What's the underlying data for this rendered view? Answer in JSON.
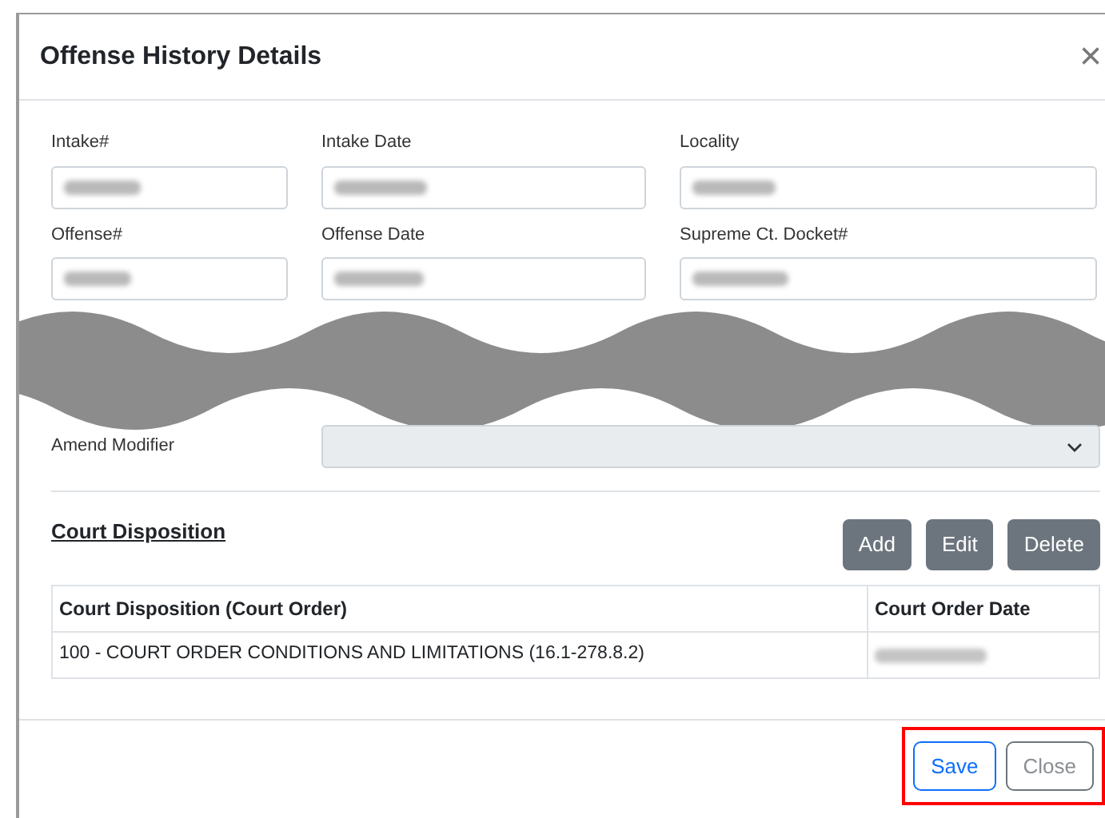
{
  "dialog": {
    "title": "Offense History Details",
    "close": "×"
  },
  "fields": [
    {
      "label": "Intake#",
      "redacted": true,
      "kind": "input"
    },
    {
      "label": "Intake Date",
      "redacted": true,
      "kind": "input"
    },
    {
      "label": "Locality",
      "redacted": true,
      "kind": "input"
    },
    {
      "label": "Offense#",
      "redacted": true,
      "kind": "input"
    },
    {
      "label": "Offense Date",
      "redacted": true,
      "kind": "input"
    },
    {
      "label": "Supreme Ct. Docket#",
      "redacted": true,
      "kind": "input"
    }
  ],
  "cut_marker": true,
  "amend_modifier": {
    "label": "Amend Modifier",
    "disabled": true
  },
  "court_disposition": {
    "title": "Court Disposition",
    "buttons": [
      "Add",
      "Edit",
      "Delete"
    ],
    "columns": [
      "Court Disposition (Court Order)",
      "Court Order Date"
    ],
    "rows": [
      {
        "disposition": "100 - COURT ORDER CONDITIONS AND LIMITATIONS (16.1-278.8.2)",
        "date_redacted": true
      }
    ]
  },
  "footer": {
    "highlighted": true,
    "buttons": [
      {
        "label": "Save",
        "kind": "primary"
      },
      {
        "label": "Close",
        "kind": "secondary"
      }
    ]
  }
}
